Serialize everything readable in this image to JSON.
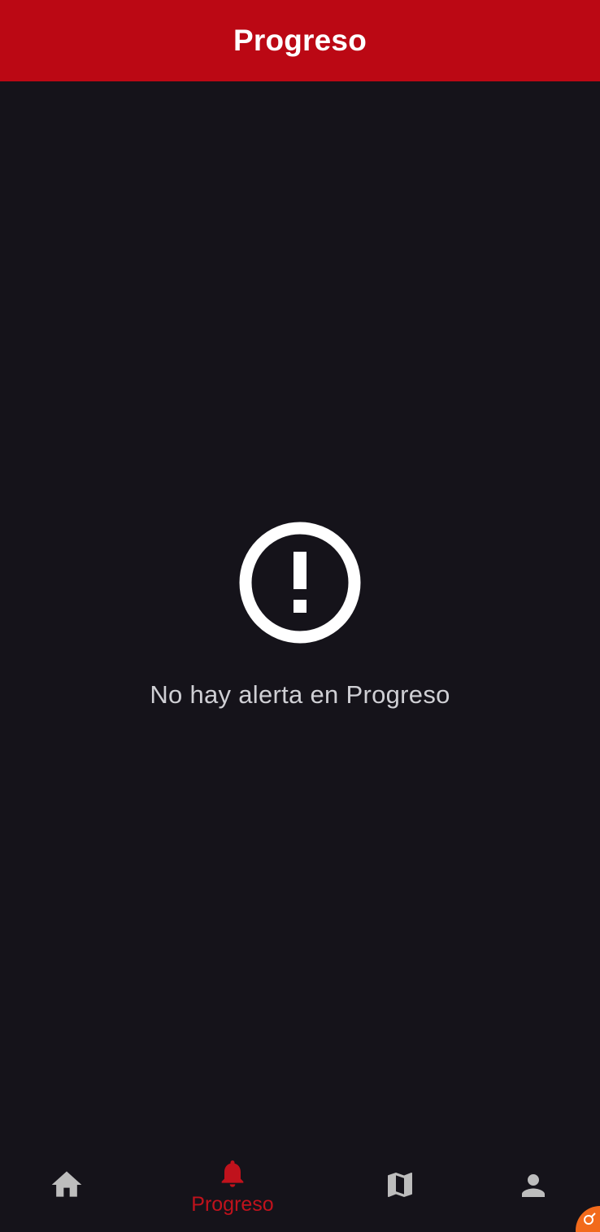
{
  "app_bar": {
    "title": "Progreso",
    "background_color": "#bb0814"
  },
  "empty_state": {
    "icon": "exclamation-circle-icon",
    "message": "No hay alerta en Progreso"
  },
  "bottom_nav": {
    "active_color": "#c0121c",
    "inactive_color": "#bdbdbd",
    "items": [
      {
        "icon": "home-icon",
        "label": "",
        "active": false
      },
      {
        "icon": "bell-icon",
        "label": "Progreso",
        "active": true
      },
      {
        "icon": "map-icon",
        "label": "",
        "active": false
      },
      {
        "icon": "person-icon",
        "label": "",
        "active": false
      }
    ]
  },
  "overlay": {
    "icon": "orange-bubble-icon",
    "color": "#f26a1b"
  }
}
